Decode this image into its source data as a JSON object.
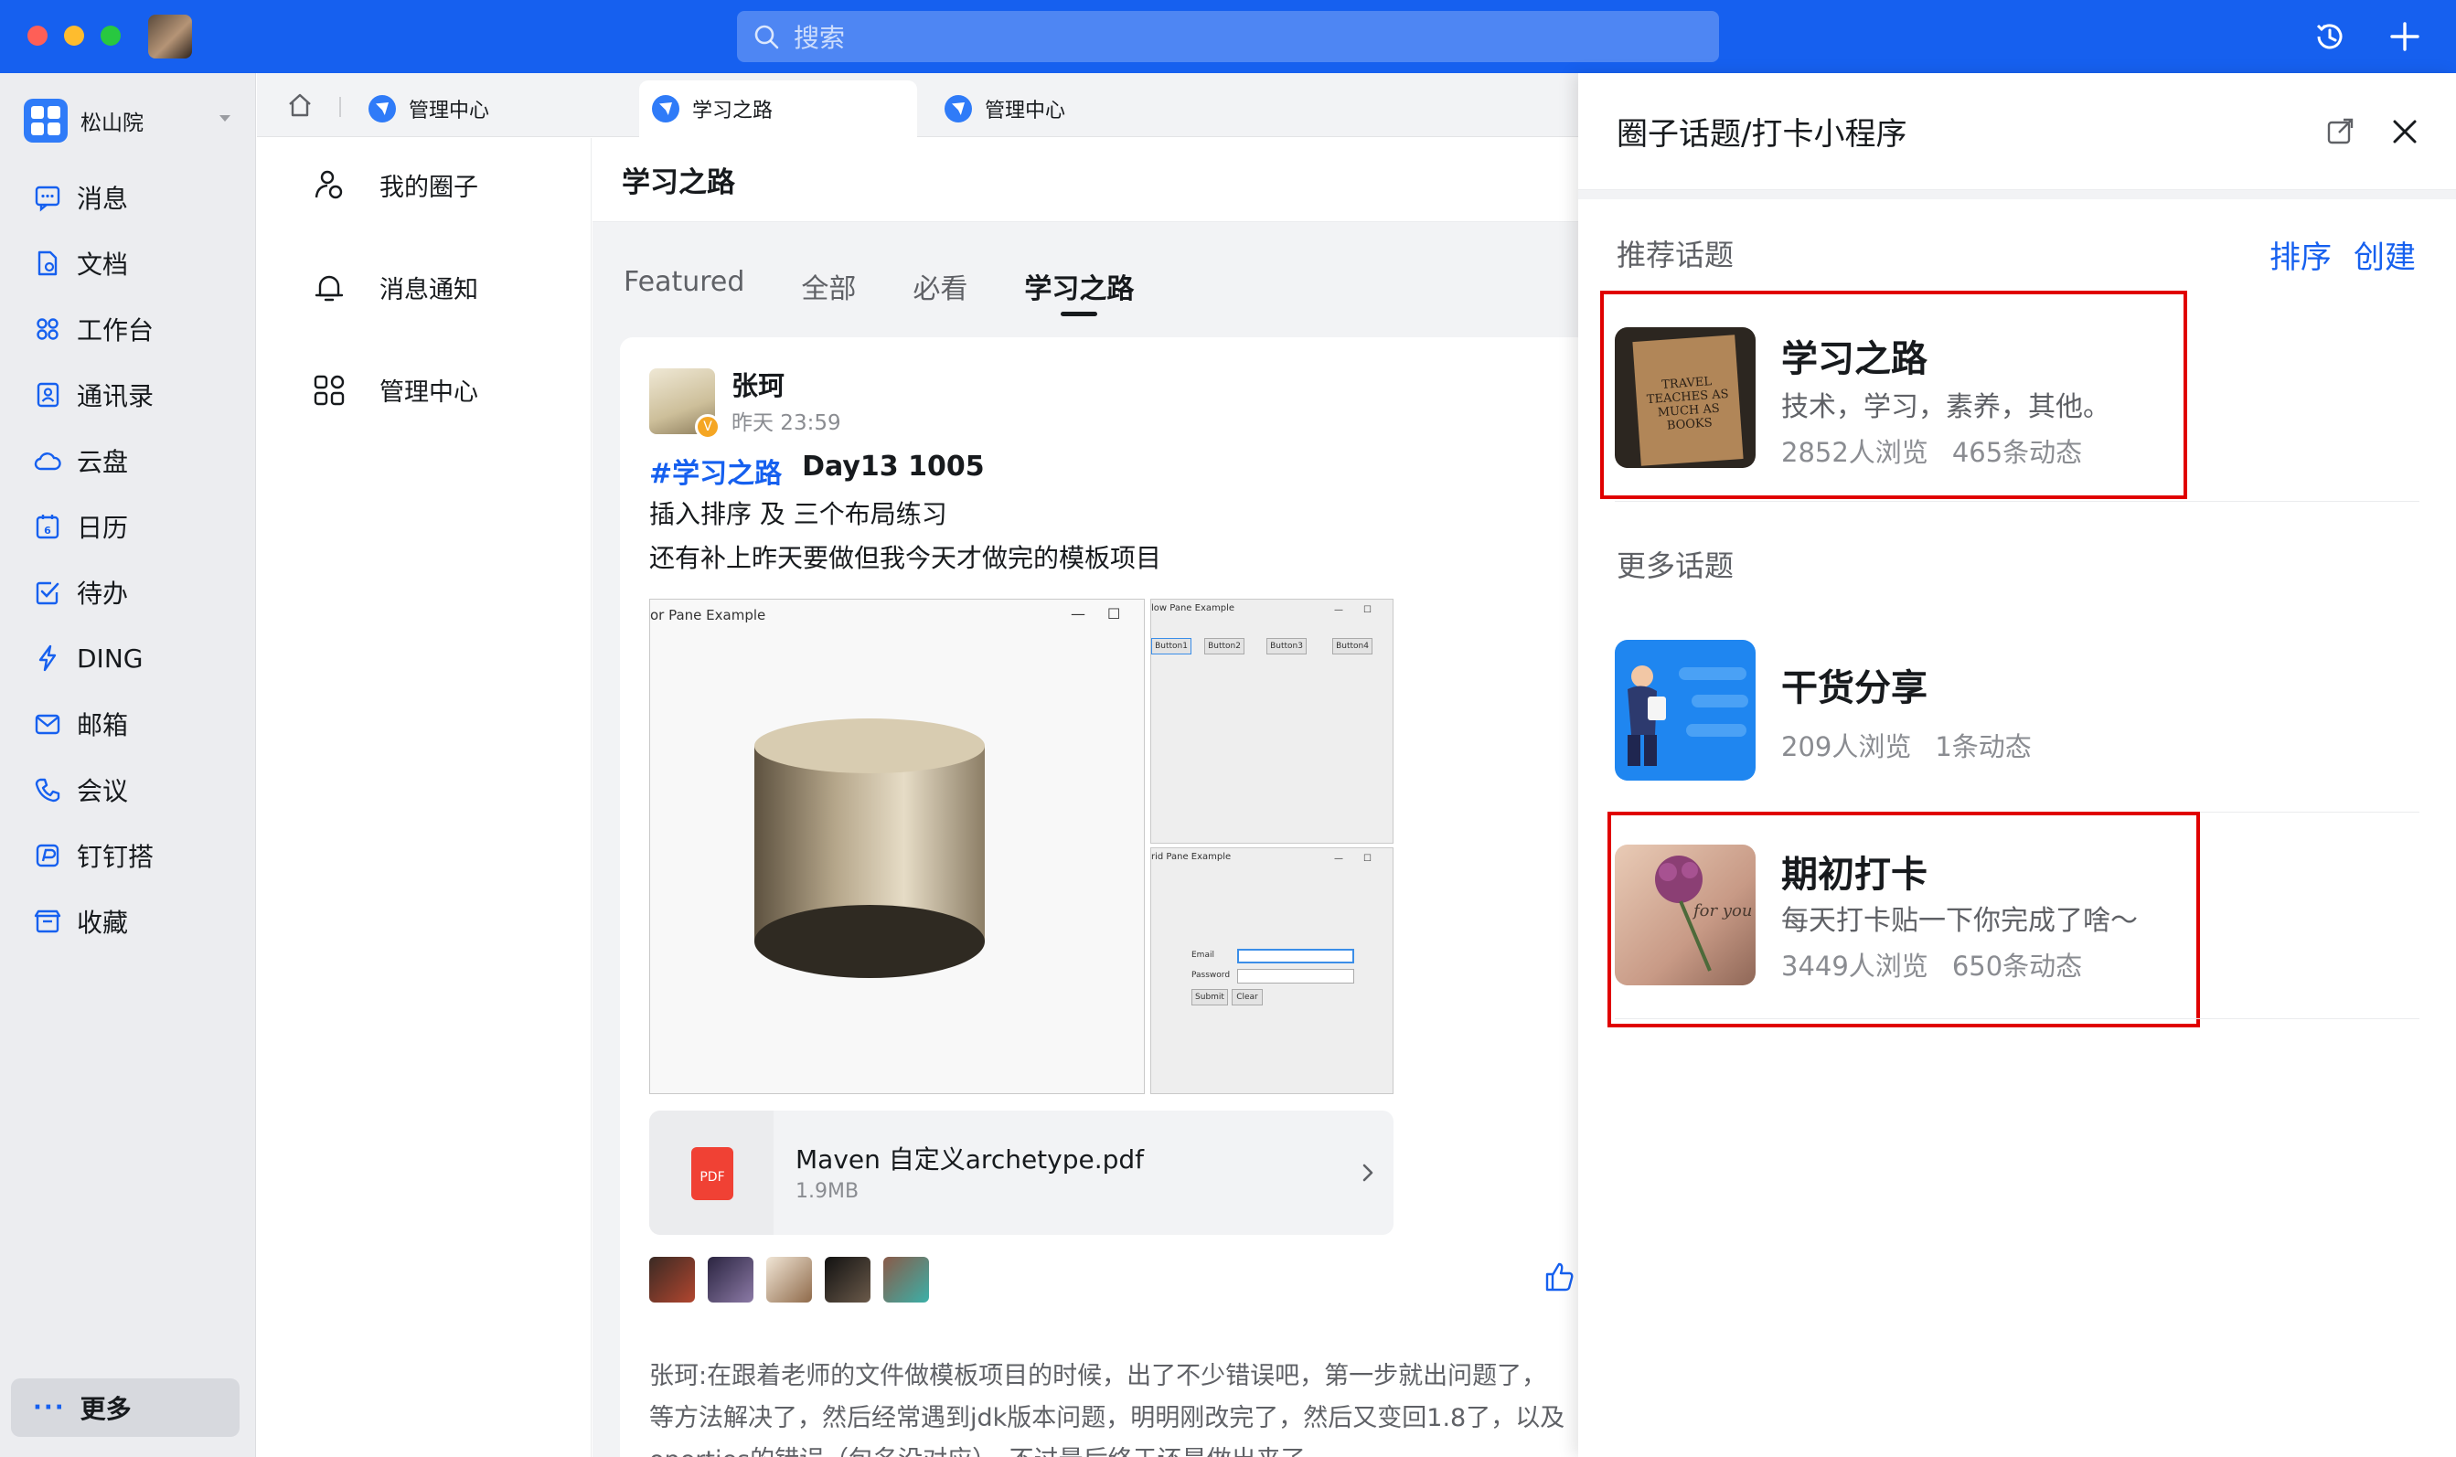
{
  "search": {
    "placeholder": "搜索"
  },
  "org": {
    "name": "松山院"
  },
  "nav": [
    {
      "label": "消息",
      "icon": "chat-icon"
    },
    {
      "label": "文档",
      "icon": "doc-icon"
    },
    {
      "label": "工作台",
      "icon": "apps-icon"
    },
    {
      "label": "通讯录",
      "icon": "contacts-icon"
    },
    {
      "label": "云盘",
      "icon": "cloud-icon"
    },
    {
      "label": "日历",
      "icon": "calendar-icon"
    },
    {
      "label": "待办",
      "icon": "todo-icon"
    },
    {
      "label": "DING",
      "icon": "ding-icon"
    },
    {
      "label": "邮箱",
      "icon": "mail-icon"
    },
    {
      "label": "会议",
      "icon": "meeting-icon"
    },
    {
      "label": "钉钉搭",
      "icon": "builder-icon"
    },
    {
      "label": "收藏",
      "icon": "favorites-icon"
    }
  ],
  "more_label": "更多",
  "tabs": [
    {
      "label": "管理中心"
    },
    {
      "label": "学习之路"
    },
    {
      "label": "管理中心"
    }
  ],
  "subnav": [
    {
      "label": "我的圈子",
      "icon": "people-icon"
    },
    {
      "label": "消息通知",
      "icon": "bell-icon"
    },
    {
      "label": "管理中心",
      "icon": "grid-icon"
    }
  ],
  "main": {
    "header": "学习之路",
    "feed_tabs": [
      "Featured",
      "全部",
      "必看",
      "学习之路"
    ],
    "post": {
      "author": "张珂",
      "time": "昨天 23:59",
      "hashtag": "#学习之路",
      "title": "Day13 1005",
      "line1": "插入排序 及 三个布局练习",
      "line2": "还有补上昨天要做但我今天才做完的模板项目",
      "screens": {
        "main_title": "or Pane Example",
        "flow_title": "low Pane Example",
        "flow_buttons": [
          "Button1",
          "Button2",
          "Button3",
          "Button4"
        ],
        "grid_title": "rid Pane Example",
        "email_label": "Email",
        "password_label": "Password",
        "submit_label": "Submit",
        "clear_label": "Clear"
      },
      "file": {
        "name": "Maven 自定义archetype.pdf",
        "size": "1.9MB",
        "type": "PDF"
      },
      "comment_author": "张珂:",
      "comment_line1": "在跟着老师的文件做模板项目的时候，出了不少错误吧，第一步就出问题了，",
      "comment_line2": "等方法解决了，然后经常遇到jdk版本问题，明明刚改完了，然后又变回1.8了，以及",
      "comment_line3": "operties的错误（包名没对应）。不过最后终于还是做出来了。"
    }
  },
  "panel": {
    "title": "圈子话题/打卡小程序",
    "recommended_label": "推荐话题",
    "sort_label": "排序",
    "create_label": "创建",
    "more_label": "更多话题",
    "featured_topic": {
      "title": "学习之路",
      "desc": "技术，学习，素养，其他。",
      "views": "2852人浏览",
      "posts": "465条动态",
      "thumb_text": "TRAVEL TEACHES AS MUCH AS BOOKS"
    },
    "topics": [
      {
        "title": "干货分享",
        "views": "209人浏览",
        "posts": "1条动态"
      },
      {
        "title": "期初打卡",
        "desc": "每天打卡贴一下你完成了啥～",
        "views": "3449人浏览",
        "posts": "650条动态",
        "thumb_text": "for you"
      }
    ]
  },
  "colors": {
    "brand": "#1660ef",
    "highlight": "#e00000"
  }
}
